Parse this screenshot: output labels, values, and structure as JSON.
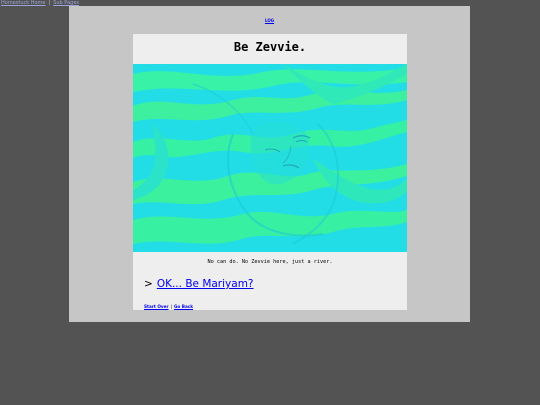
{
  "top_nav": {
    "left_link": "Homestuck Home",
    "separator": "|",
    "right_link": "Sub Pages"
  },
  "log_link": "LOG",
  "panel": {
    "title": "Be Zevvie.",
    "caption": "No can do. No Zevvie here, just a river.",
    "command_prefix": ">",
    "command_link": "OK... Be Mariyam?"
  },
  "footer": {
    "start_over": "Start Over",
    "separator": "|",
    "go_back": "Go Back"
  },
  "colors": {
    "page_bg": "#535353",
    "outer_bg": "#c6c6c6",
    "panel_bg": "#eeeeee",
    "river_cyan": "#1fdde6",
    "river_green": "#35f3a6",
    "link": "#0000ee"
  },
  "image": {
    "description_icon": "river-face-illustration"
  }
}
